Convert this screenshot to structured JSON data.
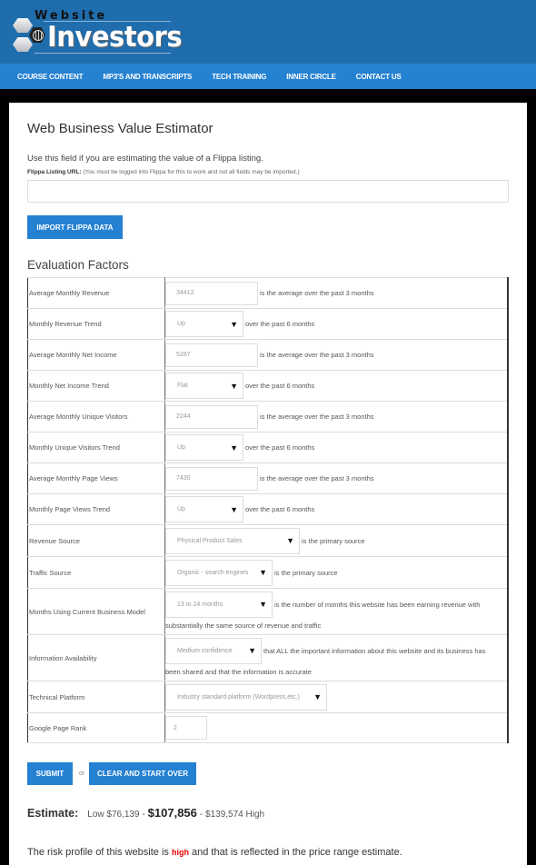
{
  "brand": {
    "logo_top": "Website",
    "logo_main": "Investors"
  },
  "nav": {
    "items": [
      {
        "label": "COURSE CONTENT"
      },
      {
        "label": "MP3'S AND TRANSCRIPTS"
      },
      {
        "label": "TECH TRAINING"
      },
      {
        "label": "INNER CIRCLE"
      },
      {
        "label": "CONTACT US"
      }
    ]
  },
  "page": {
    "title": "Web Business Value Estimator",
    "hint": "Use this field if you are estimating the value of a Flippa listing.",
    "url_label": "Flippa Listing URL:",
    "url_note": "(You must be logged into Flippa for this to work and not all fields may be imported.)",
    "url_value": "",
    "import_button": "IMPORT FLIPPA DATA",
    "section_title": "Evaluation Factors"
  },
  "factors": [
    {
      "label": "Average Monthly Revenue",
      "value": "34412",
      "suffix": "is the average over the past 3 months"
    },
    {
      "label": "Monthly Revenue Trend",
      "value": "Up",
      "suffix": "over the past 6 months"
    },
    {
      "label": "Average Monthly Net Income",
      "value": "5287",
      "suffix": "is the average over the past 3 months"
    },
    {
      "label": "Monthly Net Income Trend",
      "value": "Flat",
      "suffix": "over the past 6 months"
    },
    {
      "label": "Average Monthly Unique Visitors",
      "value": "2244",
      "suffix": "is the average over the past 3 months"
    },
    {
      "label": "Monthly Unique Visitors Trend",
      "value": "Up",
      "suffix": "over the past 6 months"
    },
    {
      "label": "Average Monthly Page Views",
      "value": "7430",
      "suffix": "is the average over the past 3 months"
    },
    {
      "label": "Monthly Page Views Trend",
      "value": "Up",
      "suffix": "over the past 6 months"
    },
    {
      "label": "Revenue Source",
      "value": "Physical Product Sales",
      "suffix": "is the primary source"
    },
    {
      "label": "Traffic Source",
      "value": "Organic - search engines",
      "suffix": "is the primary source"
    },
    {
      "label": "Months Using Current Business Model",
      "value": "13 to 24 months",
      "suffix": "is the number of months this website has been earning revenue with",
      "suffix2": "substantially the same source of revenue and traffic"
    },
    {
      "label": "Information Availability",
      "value": "Medium confidence",
      "suffix": "that ALL the important information about this website and its business has",
      "suffix2": "been shared and that the information is accurate"
    },
    {
      "label": "Technical Platform",
      "value": "Industry standard platform (Wordpress,etc.)",
      "suffix": ""
    },
    {
      "label": "Google Page Rank",
      "value": "2",
      "suffix": ""
    }
  ],
  "actions": {
    "submit": "SUBMIT",
    "or": "or",
    "clear": "CLEAR AND START OVER"
  },
  "estimate": {
    "label": "Estimate:",
    "low": "Low $76,139 -",
    "mid": "$107,856",
    "high": "- $139,574 High"
  },
  "risk": {
    "prefix": "The risk profile of this website is",
    "level": "high",
    "suffix": "and that is reflected in the price range estimate.",
    "level_color": "#e00000"
  },
  "colors": {
    "header": "#1f6dad",
    "nav": "#2581d2",
    "button": "#2581d2"
  }
}
